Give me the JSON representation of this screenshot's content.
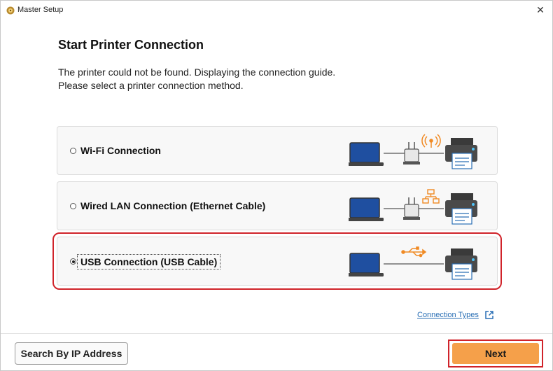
{
  "window": {
    "title": "Master Setup",
    "close_glyph": "✕"
  },
  "content": {
    "heading": "Start Printer Connection",
    "description_line1": "The printer could not be found. Displaying the connection guide.",
    "description_line2": "Please select a printer connection method."
  },
  "options": [
    {
      "label": "Wi-Fi Connection",
      "selected": false,
      "icon": "wifi-router-icon"
    },
    {
      "label": "Wired LAN Connection (Ethernet Cable)",
      "selected": false,
      "icon": "lan-network-icon"
    },
    {
      "label": "USB Connection (USB Cable)",
      "selected": true,
      "icon": "usb-icon"
    }
  ],
  "links": {
    "connection_types": "Connection Types"
  },
  "buttons": {
    "search_ip": "Search By IP Address",
    "next": "Next"
  },
  "colors": {
    "accent_orange": "#f5a04a",
    "highlight_red": "#d0232a",
    "link_blue": "#2a6fb5",
    "laptop_blue": "#1f4fa0"
  }
}
